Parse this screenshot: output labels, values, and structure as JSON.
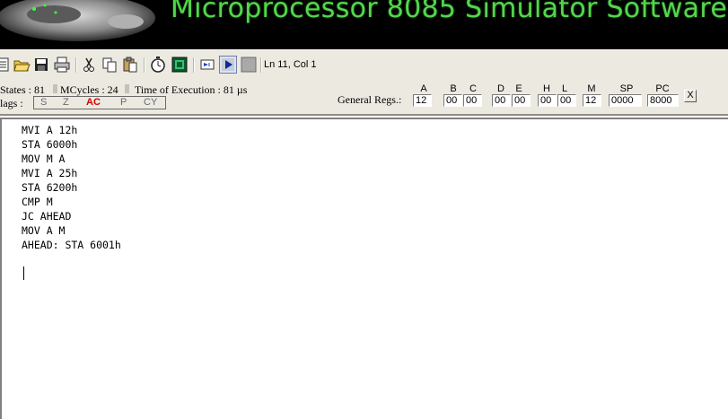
{
  "banner": {
    "title": "Microprocessor 8085 Simulator Software"
  },
  "toolbar": {
    "buttons": [
      "new-icon",
      "open-icon",
      "save-icon",
      "print-icon",
      "cut-icon",
      "copy-icon",
      "paste-icon",
      "timer-icon",
      "assemble-icon",
      "step-icon",
      "run-icon",
      "stop-icon"
    ],
    "cursor_position": "Ln 11, Col 1"
  },
  "status": {
    "tstates": "States : 81",
    "mcycles": "MCycles : 24",
    "time": "Time of Execution : 81 µs",
    "flags_label": "lags :",
    "flags": [
      {
        "name": "S",
        "set": false
      },
      {
        "name": "Z",
        "set": false
      },
      {
        "name": "AC",
        "set": true
      },
      {
        "name": "P",
        "set": false
      },
      {
        "name": "CY",
        "set": false
      }
    ],
    "set_color": "#d40000"
  },
  "registers": {
    "label": "General Regs.:",
    "A": {
      "name": "A",
      "value": "12"
    },
    "B": {
      "name": "B",
      "value": "00"
    },
    "C": {
      "name": "C",
      "value": "00"
    },
    "D": {
      "name": "D",
      "value": "00"
    },
    "E": {
      "name": "E",
      "value": "00"
    },
    "H": {
      "name": "H",
      "value": "00"
    },
    "L": {
      "name": "L",
      "value": "00"
    },
    "M": {
      "name": "M",
      "value": "12"
    },
    "SP": {
      "name": "SP",
      "value": "0000"
    },
    "PC": {
      "name": "PC",
      "value": "8000"
    },
    "close_label": "X"
  },
  "editor": {
    "lines": [
      "MVI A 12h",
      "STA 6000h",
      "MOV M A",
      "MVI A 25h",
      "STA 6200h",
      "CMP M",
      "JC AHEAD",
      "MOV A M",
      "AHEAD: STA 6001h",
      ""
    ]
  }
}
